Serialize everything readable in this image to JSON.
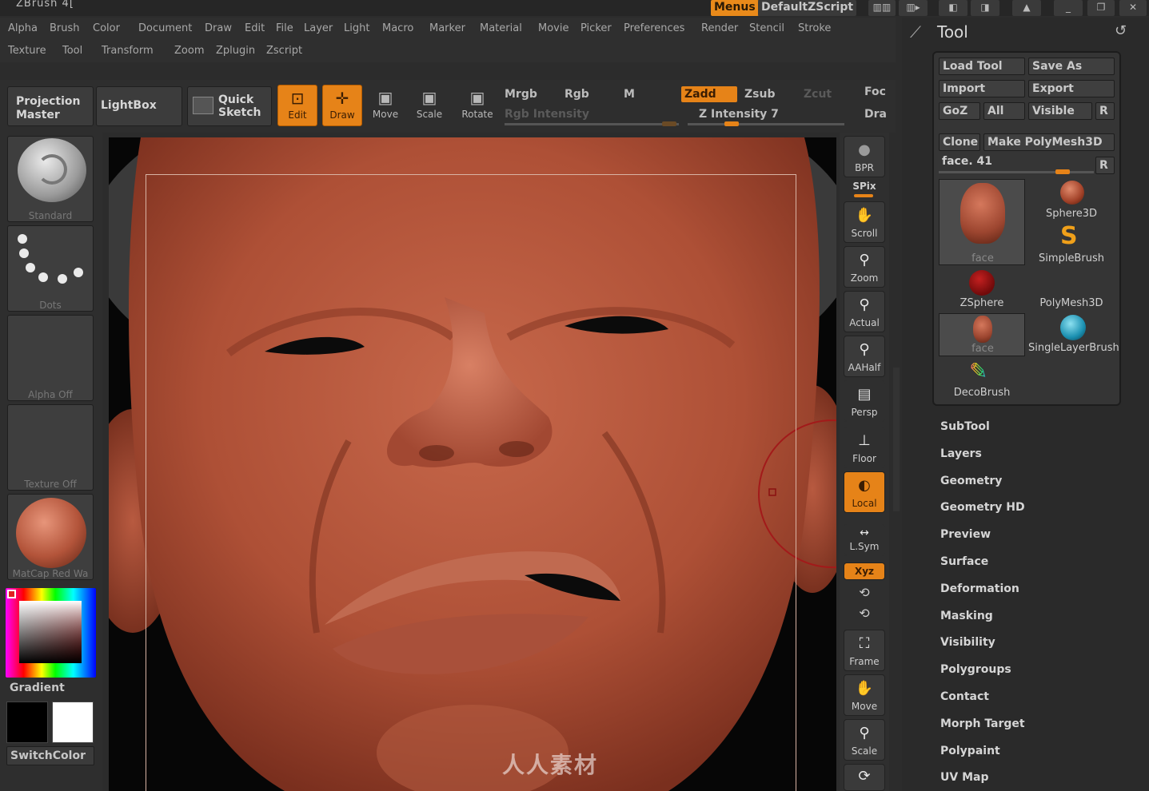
{
  "titlebar": {
    "app_title": "ZBrush 4[",
    "menus_label": "Menus",
    "script_label": "DefaultZScript"
  },
  "menu_row1": [
    "Alpha",
    "Brush",
    "Color",
    "Document",
    "Draw",
    "Edit",
    "File",
    "Layer",
    "Light",
    "Macro",
    "Marker",
    "Material",
    "Movie",
    "Picker",
    "Preferences",
    "Render",
    "Stencil",
    "Stroke"
  ],
  "menu_row2": [
    "Texture",
    "Tool",
    "Transform",
    "Zoom",
    "Zplugin",
    "Zscript"
  ],
  "toolbar": {
    "projection_master": "Projection Master",
    "lightbox": "LightBox",
    "quick_sketch": "Quick Sketch",
    "edit": "Edit",
    "draw": "Draw",
    "move": "Move",
    "scale": "Scale",
    "rotate": "Rotate",
    "mrgb": "Mrgb",
    "rgb": "Rgb",
    "m": "M",
    "rgb_intensity": "Rgb Intensity",
    "zadd": "Zadd",
    "zsub": "Zsub",
    "zcut": "Zcut",
    "z_intensity": "Z Intensity 7",
    "foc": "Foc",
    "dra": "Dra"
  },
  "left": {
    "brush": "Standard",
    "stroke": "Dots",
    "alpha": "Alpha Off",
    "texture": "Texture Off",
    "material": "MatCap Red Wa",
    "gradient": "Gradient",
    "switch_color": "SwitchColor"
  },
  "shelf": {
    "bpr": "BPR",
    "spix": "SPix",
    "scroll": "Scroll",
    "zoom": "Zoom",
    "actual": "Actual",
    "aahalf": "AAHalf",
    "persp": "Persp",
    "floor": "Floor",
    "local": "Local",
    "lsym": "L.Sym",
    "xyz": "Xyz",
    "frame": "Frame",
    "move": "Move",
    "scale": "Scale"
  },
  "tool_panel": {
    "title": "Tool",
    "load_tool": "Load Tool",
    "save_as": "Save As",
    "import": "Import",
    "export": "Export",
    "goz": "GoZ",
    "all": "All",
    "visible": "Visible",
    "r": "R",
    "clone": "Clone",
    "make_polymesh": "Make PolyMesh3D",
    "current": "face. 41",
    "items": [
      "face",
      "Sphere3D",
      "SimpleBrush",
      "ZSphere",
      "PolyMesh3D",
      "face",
      "SingleLayerBrush",
      "DecoBrush"
    ],
    "sections": [
      "SubTool",
      "Layers",
      "Geometry",
      "Geometry HD",
      "Preview",
      "Surface",
      "Deformation",
      "Masking",
      "Visibility",
      "Polygroups",
      "Contact",
      "Morph Target",
      "Polypaint",
      "UV Map"
    ]
  },
  "watermark": "人人素材",
  "colors": {
    "accent": "#e68318",
    "skin": "#b3543a",
    "skin_light": "#d17a5e",
    "skin_dark": "#7e3221",
    "background": "#2c2c2c"
  }
}
